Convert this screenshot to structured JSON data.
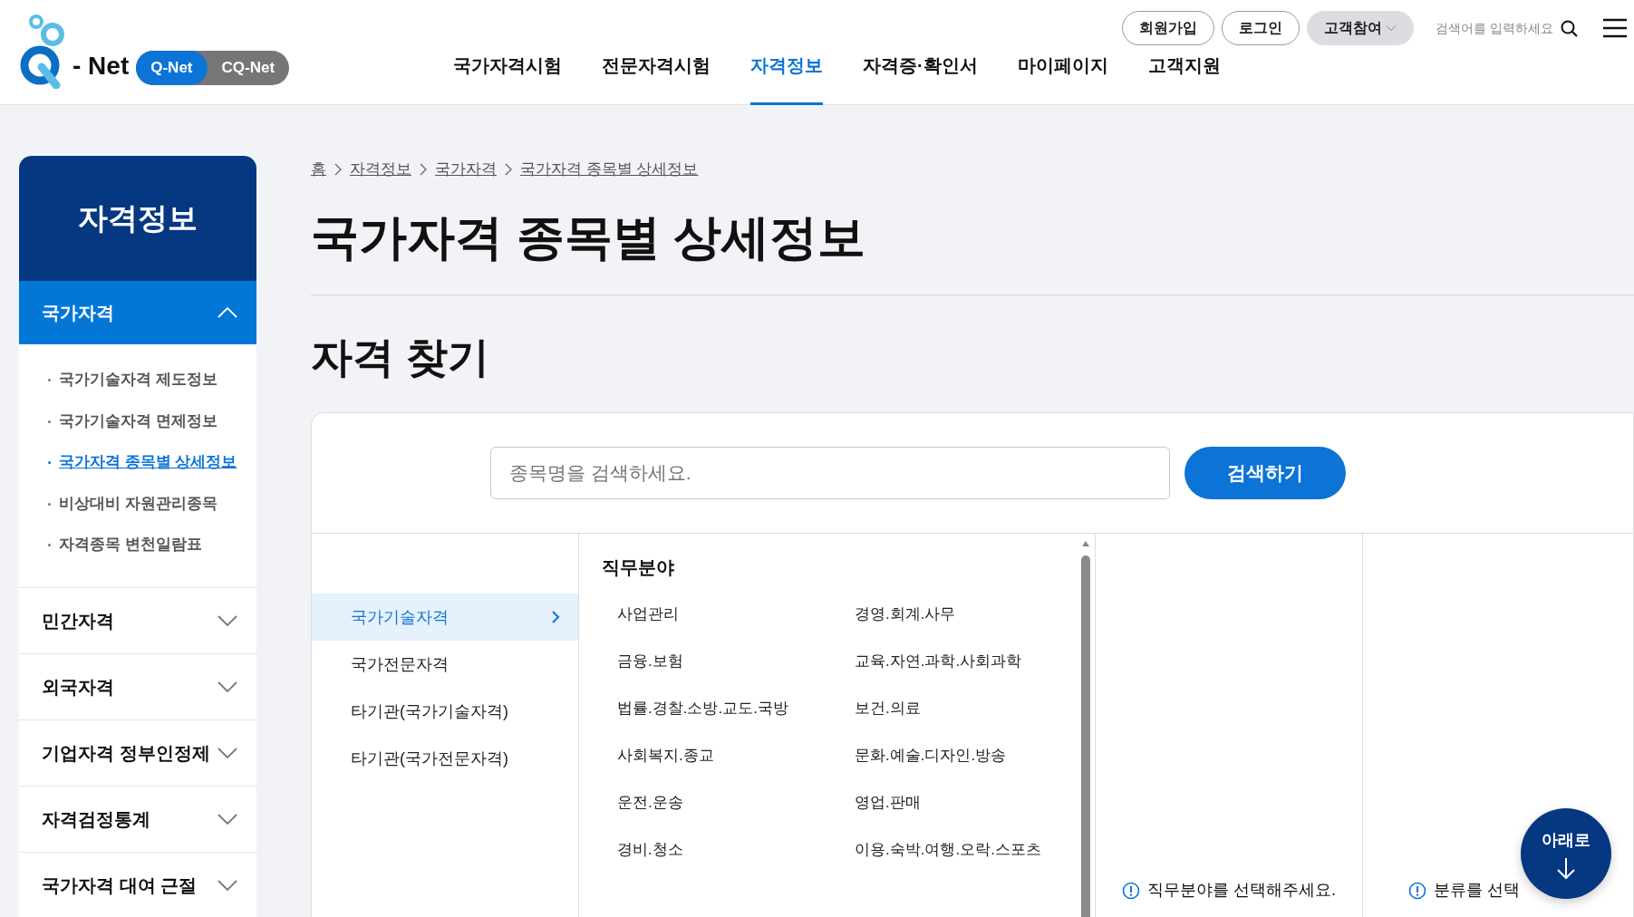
{
  "header": {
    "logo": "- Net",
    "site_switch": [
      {
        "label": "Q-Net",
        "selected": true
      },
      {
        "label": "CQ-Net",
        "selected": false
      }
    ],
    "utility_buttons": [
      {
        "label": "회원가입",
        "kind": "outline"
      },
      {
        "label": "로그인",
        "kind": "outline"
      },
      {
        "label": "고객참여",
        "kind": "dropdown"
      }
    ],
    "search": {
      "placeholder": "검색어를 입력하세요"
    },
    "nav": [
      {
        "label": "국가자격시험",
        "selected": false
      },
      {
        "label": "전문자격시험",
        "selected": false
      },
      {
        "label": "자격정보",
        "selected": true
      },
      {
        "label": "자격증·확인서",
        "selected": false
      },
      {
        "label": "마이페이지",
        "selected": false
      },
      {
        "label": "고객지원",
        "selected": false
      }
    ]
  },
  "sidebar": {
    "title": "자격정보",
    "sections": [
      {
        "label": "국가자격",
        "expanded": true,
        "children": [
          {
            "label": "국가기술자격 제도정보",
            "selected": false
          },
          {
            "label": "국가기술자격 면제정보",
            "selected": false
          },
          {
            "label": "국가자격 종목별 상세정보",
            "selected": true
          },
          {
            "label": "비상대비 자원관리종목",
            "selected": false
          },
          {
            "label": "자격종목 변천일람표",
            "selected": false
          }
        ]
      },
      {
        "label": "민간자격",
        "expanded": false
      },
      {
        "label": "외국자격",
        "expanded": false
      },
      {
        "label": "기업자격 정부인정제",
        "expanded": false
      },
      {
        "label": "자격검정통계",
        "expanded": false
      },
      {
        "label": "국가자격 대여 근절",
        "expanded": false
      }
    ]
  },
  "breadcrumb": [
    "홈",
    "자격정보",
    "국가자격",
    "국가자격 종목별 상세정보"
  ],
  "page_title": "국가자격 종목별 상세정보",
  "section_title": "자격 찾기",
  "finder": {
    "search": {
      "placeholder": "종목명을 검색하세요.",
      "button": "검색하기"
    },
    "categories": [
      {
        "label": "국가기술자격",
        "selected": true
      },
      {
        "label": "국가전문자격",
        "selected": false
      },
      {
        "label": "타기관(국가기술자격)",
        "selected": false
      },
      {
        "label": "타기관(국가전문자격)",
        "selected": false
      }
    ],
    "field_heading": "직무분야",
    "fields": [
      "사업관리",
      "경영.회계.사무",
      "금융.보험",
      "교육.자연.과학.사회과학",
      "법률.경찰.소방.교도.국방",
      "보건.의료",
      "사회복지.종교",
      "문화.예술.디자인.방송",
      "운전.운송",
      "영업.판매",
      "경비.청소",
      "이용.숙박.여행.오락.스포츠"
    ],
    "hints": [
      "직무분야를 선택해주세요.",
      "분류를 선택"
    ]
  },
  "floating_button": "아래로"
}
